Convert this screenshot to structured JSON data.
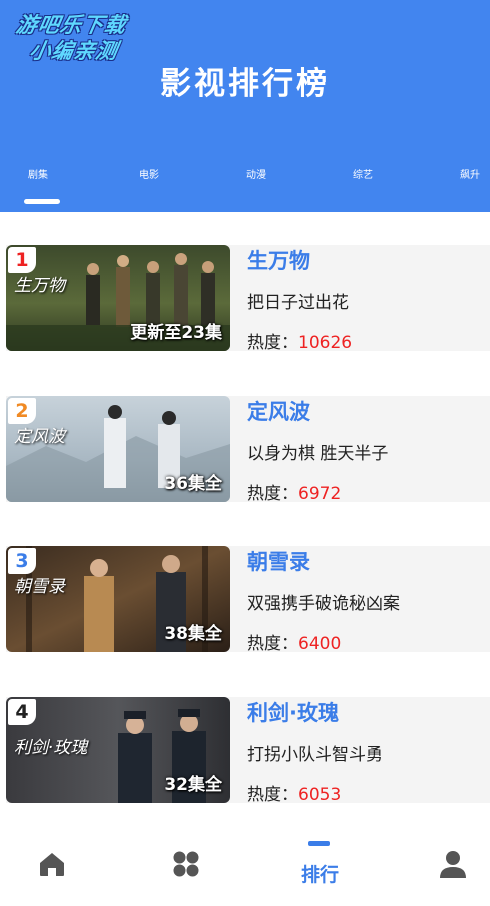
{
  "watermark": {
    "line1": "游吧乐下载",
    "line2": "小编亲测"
  },
  "header": {
    "title": "影视排行榜"
  },
  "tabs": [
    {
      "label": "剧集",
      "active": true
    },
    {
      "label": "电影",
      "active": false
    },
    {
      "label": "动漫",
      "active": false
    },
    {
      "label": "综艺",
      "active": false
    },
    {
      "label": "飙升",
      "active": false
    }
  ],
  "items": [
    {
      "rank": "1",
      "rank_color": "#ee2222",
      "poster_title": "生万物",
      "episodes": "更新至23集",
      "name": "生万物",
      "desc": "把日子过出花",
      "heat_label": "热度：",
      "heat_value": "10626"
    },
    {
      "rank": "2",
      "rank_color": "#f08a24",
      "poster_title": "定风波",
      "episodes": "36集全",
      "name": "定风波",
      "desc": "以身为棋 胜天半子",
      "heat_label": "热度：",
      "heat_value": "6972"
    },
    {
      "rank": "3",
      "rank_color": "#3b7de8",
      "poster_title": "朝雪录",
      "episodes": "38集全",
      "name": "朝雪录",
      "desc": "双强携手破诡秘凶案",
      "heat_label": "热度：",
      "heat_value": "6400"
    },
    {
      "rank": "4",
      "rank_color": "#222222",
      "poster_title": "利剑·玫瑰",
      "episodes": "32集全",
      "name": "利剑·玫瑰",
      "desc": "打拐小队斗智斗勇",
      "heat_label": "热度：",
      "heat_value": "6053"
    }
  ],
  "bottom_nav": [
    {
      "icon": "home-icon",
      "label": ""
    },
    {
      "icon": "category-icon",
      "label": ""
    },
    {
      "icon": "ranking-icon",
      "label": "排行",
      "active": true
    },
    {
      "icon": "profile-icon",
      "label": ""
    }
  ],
  "colors": {
    "header_bg": "#4285ef",
    "accent": "#3b7de8",
    "heat_value": "#ee2222",
    "nav_icon": "#555555"
  }
}
